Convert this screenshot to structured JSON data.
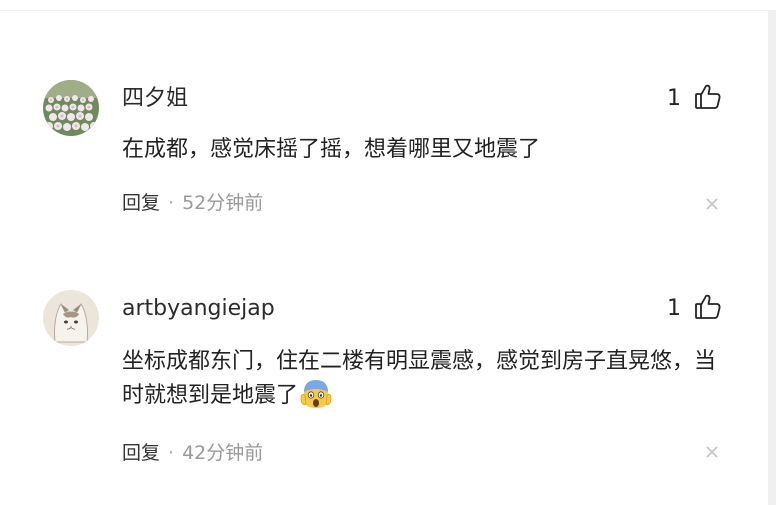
{
  "comments": [
    {
      "username": "四夕姐",
      "likes": "1",
      "text": "在成都，感觉床摇了摇，想着哪里又地震了",
      "reply_label": "回复",
      "separator": "·",
      "time": "52分钟前",
      "avatar_icon": "flower-field-avatar",
      "like_icon": "thumbs-up-icon",
      "close_icon": "close-icon"
    },
    {
      "username": "artbyangiejap",
      "likes": "1",
      "text": "坐标成都东门，住在二楼有明显震感，感觉到房子直晃悠，当时就想到是地震了",
      "emoji": "screaming-face-emoji",
      "reply_label": "回复",
      "separator": "·",
      "time": "42分钟前",
      "avatar_icon": "cat-avatar",
      "like_icon": "thumbs-up-icon",
      "close_icon": "close-icon"
    }
  ],
  "colors": {
    "text": "#222222",
    "meta": "#999999",
    "divider": "#efefef"
  }
}
